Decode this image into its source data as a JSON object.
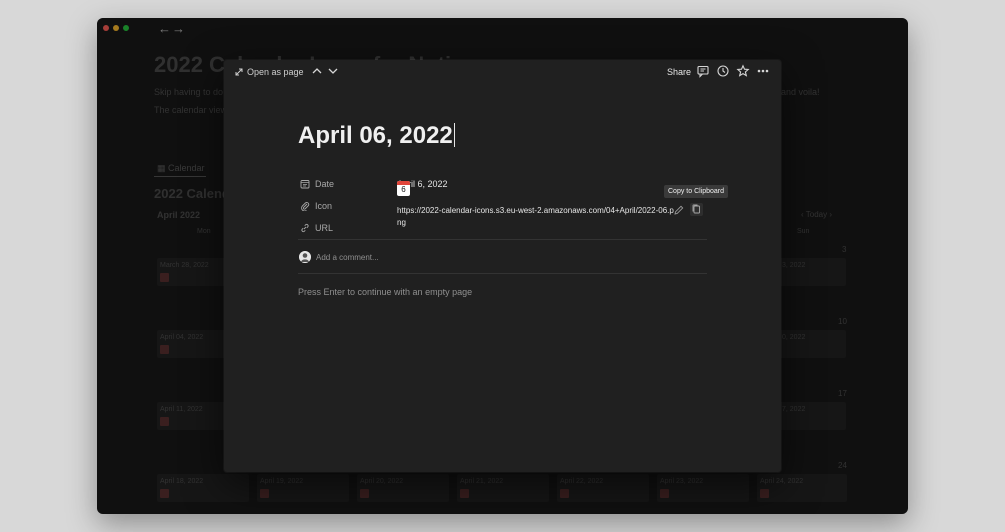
{
  "background_page": {
    "title": "2022 Calendar Icons for Notion",
    "intro_line1": "Skip having to do",
    "intro_line1_end": "and voila!",
    "intro_line2": "The calendar view",
    "view_tab": "Calendar",
    "section_title": "2022 Calendar",
    "month": "April 2022",
    "today_label": "Today",
    "weekday_first": "Mon",
    "weekday_last": "Sun",
    "week_end_nums": [
      "3",
      "10",
      "17",
      "24"
    ],
    "left_col_dates": [
      "March 28, 2022",
      "April 04, 2022",
      "April 11, 2022",
      "April 18, 2022"
    ],
    "right_col_dates": [
      "3, 2022",
      "0, 2022",
      "7, 2022",
      "April 24, 2022"
    ],
    "bottom_row": [
      "April 19, 2022",
      "April 20, 2022",
      "April 21, 2022",
      "April 22, 2022",
      "April 23, 2022"
    ]
  },
  "modal": {
    "open_as_page": "Open as page",
    "share": "Share",
    "title": "April 06, 2022",
    "properties": {
      "date_label": "Date",
      "date_value": "April 6, 2022",
      "icon_label": "Icon",
      "icon_day": "6",
      "url_label": "URL",
      "url_value": "https://2022-calendar-icons.s3.eu-west-2.amazonaws.com/04+April/2022-06.png"
    },
    "tooltip": "Copy to Clipboard",
    "add_comment": "Add a comment...",
    "empty_hint": "Press Enter to continue with an empty page"
  },
  "colors": {
    "window_bg": "#191919",
    "modal_bg": "#202020",
    "calendar_icon_red": "#e0453a"
  }
}
